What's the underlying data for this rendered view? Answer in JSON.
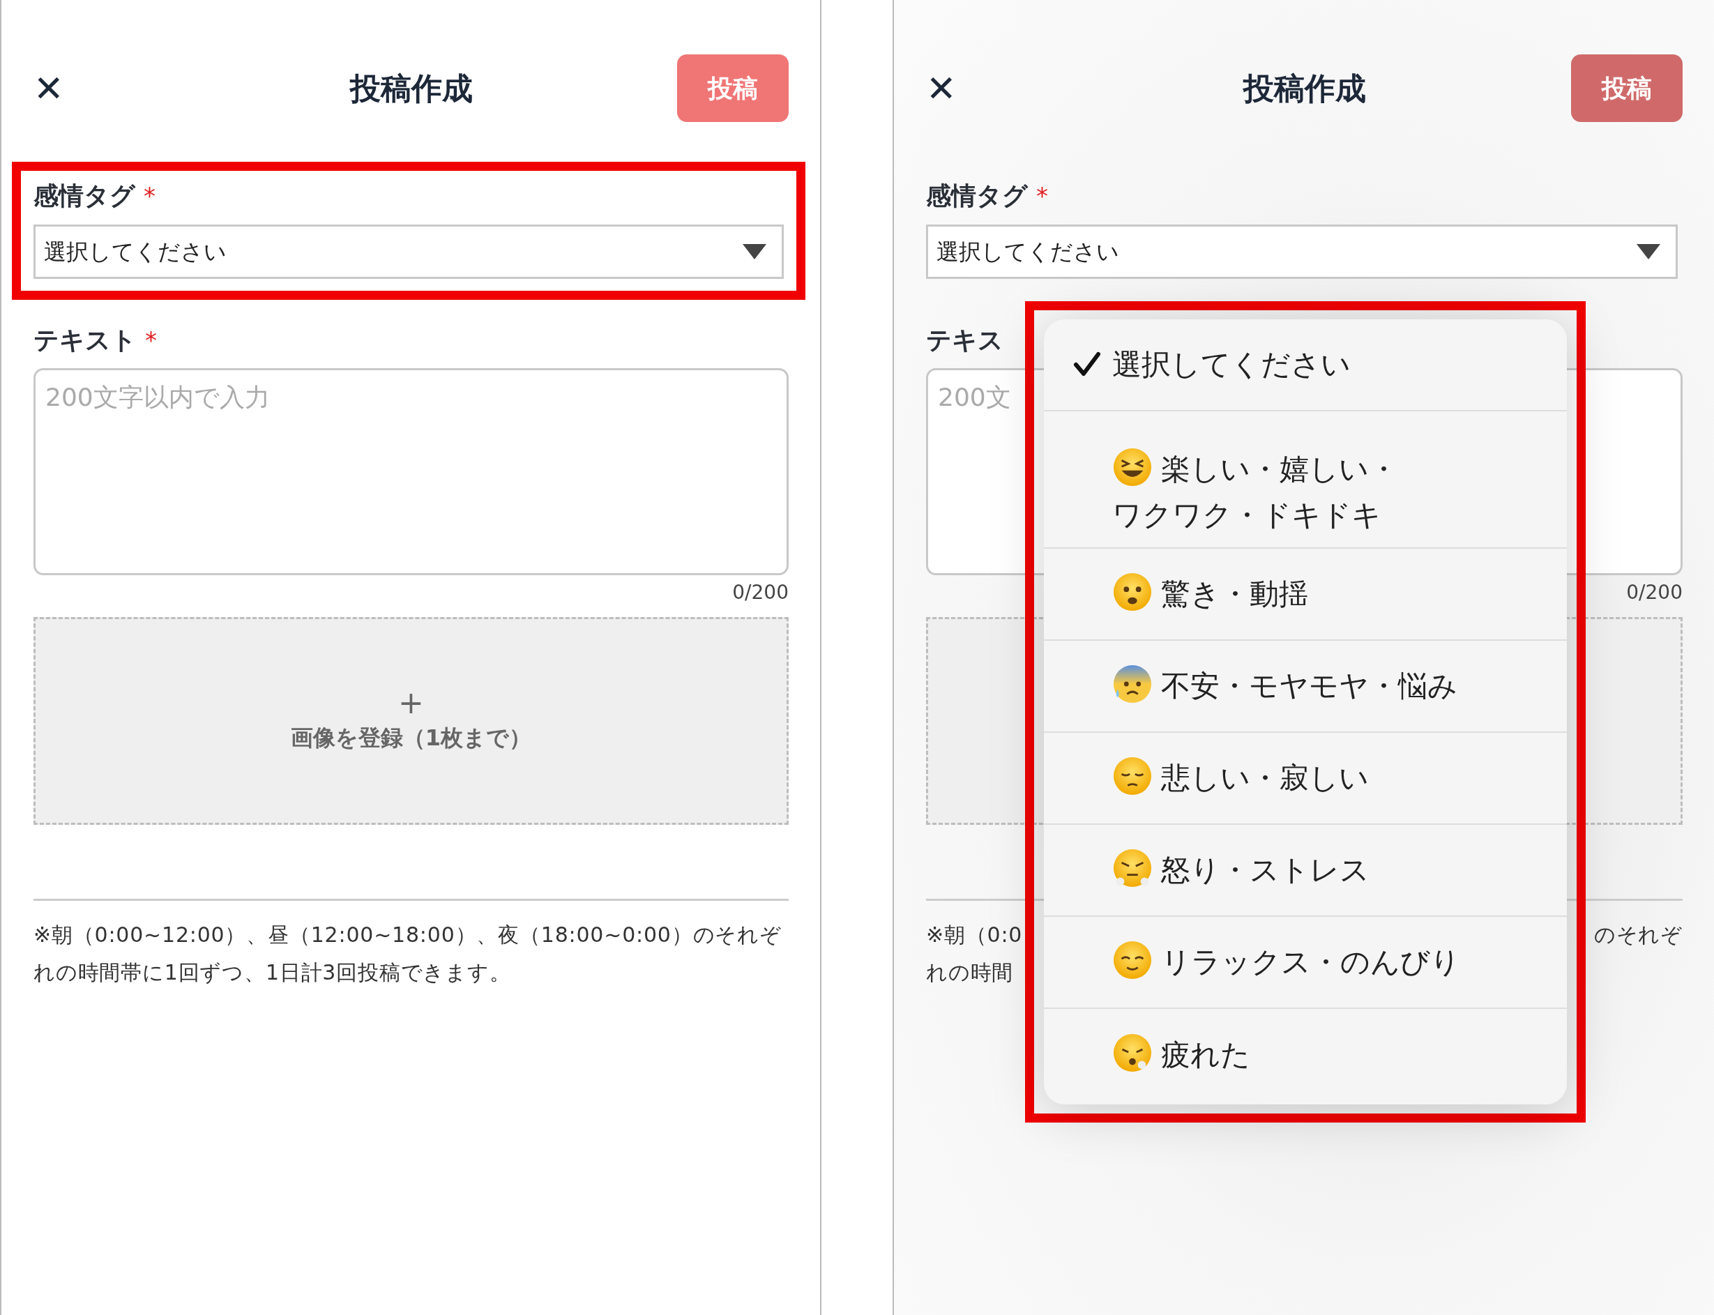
{
  "panels": [
    {
      "dimmed": false,
      "header": {
        "close": "✕",
        "title": "投稿作成",
        "post_button": "投稿"
      },
      "emotion_tag": {
        "label": "感情タグ",
        "required_mark": "*",
        "value": "選択してください",
        "highlighted": true
      },
      "text_field": {
        "label": "テキスト",
        "required_mark": "*",
        "placeholder": "200文字以内で入力",
        "counter": "0/200"
      },
      "image_upload": {
        "plus": "+",
        "label": "画像を登録（1枚まで）"
      },
      "note": {
        "lines": [
          "※朝（0:00~12:00）、昼（12:00~18:00）、夜（18:00~0:00）のそれぞれの時間帯に1回ずつ、1日計3回投稿できます。"
        ]
      }
    },
    {
      "dimmed": true,
      "header": {
        "close": "✕",
        "title": "投稿作成",
        "post_button": "投稿"
      },
      "emotion_tag": {
        "label": "感情タグ",
        "required_mark": "*",
        "value": "選択してください"
      },
      "text_field": {
        "label": "テキス",
        "placeholder": "200文",
        "counter": "0/200"
      },
      "note": {
        "fragments": [
          "※朝（0:0",
          "のそれぞ",
          "れの時間"
        ]
      },
      "dropdown": {
        "highlighted": true,
        "options": [
          {
            "kind": "plain",
            "label": "選択してください",
            "selected": true
          },
          {
            "kind": "emotion",
            "label": "楽しい・嬉しい・ワクワク・ドキドキ",
            "selected": false
          },
          {
            "kind": "emotion",
            "label": "驚き・動揺",
            "selected": false
          },
          {
            "kind": "emotion",
            "label": "不安・モヤモヤ・悩み",
            "selected": false
          },
          {
            "kind": "emotion",
            "label": "悲しい・寂しい",
            "selected": false
          },
          {
            "kind": "emotion",
            "label": "怒り・ストレス",
            "selected": false
          },
          {
            "kind": "emotion",
            "label": "リラックス・のんびり",
            "selected": false
          },
          {
            "kind": "emotion",
            "label": "疲れた",
            "selected": false
          }
        ]
      }
    }
  ]
}
